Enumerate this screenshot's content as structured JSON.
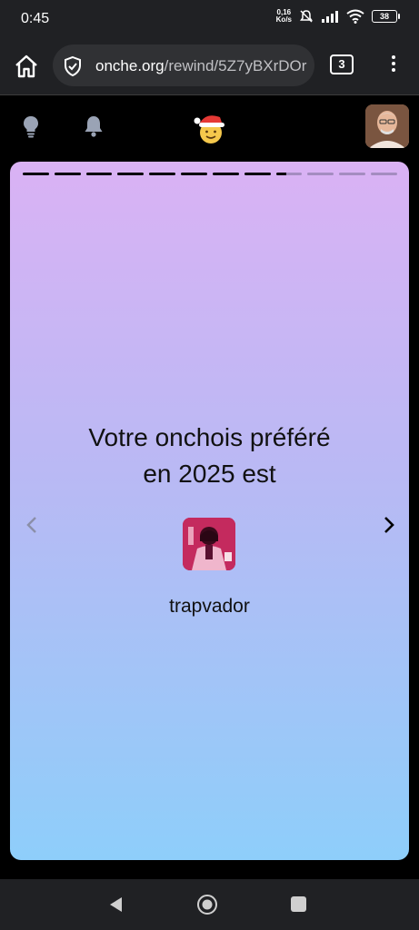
{
  "status": {
    "time": "0:45",
    "net_speed_value": "0,16",
    "net_speed_unit": "Ko/s",
    "battery": "38"
  },
  "browser": {
    "url_host": "onche.org",
    "url_path": "/rewind/5Z7yBXrDOr",
    "tab_count": "3"
  },
  "story": {
    "headline_line1": "Votre onchois préféré",
    "headline_line2": "en 2025 est",
    "onchois_name": "trapvador",
    "segments_total": 12,
    "segments_done": 8
  },
  "colors": {
    "gradient_top": "#dab2f4",
    "gradient_bottom": "#8ecefa"
  },
  "icons": {
    "home": "home-icon",
    "shield": "shield-check-icon",
    "menu": "more-vert-icon",
    "idea": "lightbulb-icon",
    "notifications": "bell-icon",
    "logo": "santa-hat-smiley-logo",
    "prev": "chevron-left-icon",
    "next": "chevron-right-icon"
  }
}
